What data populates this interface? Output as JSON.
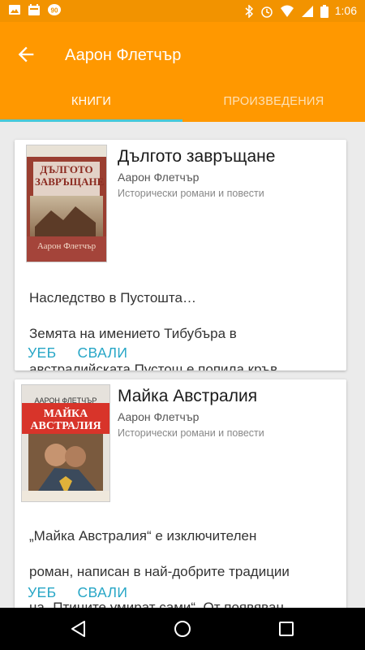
{
  "status_bar": {
    "time": "1:06"
  },
  "header": {
    "title": "Аарон Флетчър"
  },
  "tabs": [
    {
      "label": "КНИГИ",
      "active": true
    },
    {
      "label": "ПРОИЗВЕДЕНИЯ",
      "active": false
    }
  ],
  "books": [
    {
      "title": "Дългото завръщане",
      "author": "Аарон Флетчър",
      "genre": "Исторически романи и повести",
      "cover_title": "ДЪЛГОТО ЗАВРЪЩАНЕ",
      "cover_author": "Аарон Флетчър",
      "description": [
        " Наследство в Пустошта…",
        " Земята на имението Тибубъра в",
        "австралийската Пустош е попила кръв…"
      ],
      "actions": {
        "web": "УЕБ",
        "download": "СВАЛИ"
      }
    },
    {
      "title": "Майка Австралия",
      "author": "Аарон Флетчър",
      "genre": "Исторически романи и повести",
      "cover_title": "МАЙКА АВСТРАЛИЯ",
      "cover_author": "ААРОН ФЛЕТЧЪР",
      "description": [
        "„Майка Австралия“ е изключителен",
        "роман, написан в най-добрите традиции",
        "на „Птиците умират сами“. От появяван…"
      ],
      "actions": {
        "web": "УЕБ",
        "download": "СВАЛИ"
      }
    }
  ],
  "colors": {
    "primary": "#ff9800",
    "status": "#f29300",
    "accent": "#26a6c6",
    "tab_indicator": "#48c8d8"
  }
}
